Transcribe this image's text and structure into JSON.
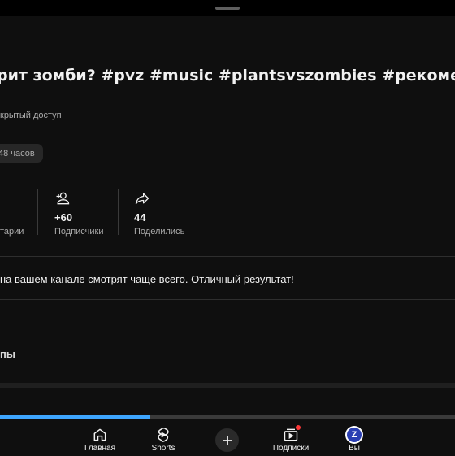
{
  "video": {
    "title": "рит зомби? #pvz #music #plantsvszombies #рекомендации",
    "visibility": "крытый доступ",
    "time_chip": "48 часов"
  },
  "stats": [
    {
      "value": "",
      "label": "тарии",
      "icon": "comment-icon"
    },
    {
      "value": "+60",
      "label": "Подписчики",
      "icon": "add-person-icon"
    },
    {
      "value": "44",
      "label": "Поделились",
      "icon": "share-icon"
    }
  ],
  "insight": {
    "text": "на вашем канале смотрят чаще всего. Отличный результат!"
  },
  "section": {
    "title": "пы"
  },
  "progress": {
    "fraction": 0.33,
    "color": "#3ea6ff"
  },
  "nav": {
    "items": [
      {
        "label": "Главная",
        "icon": "home-icon"
      },
      {
        "label": "Shorts",
        "icon": "shorts-icon"
      },
      {
        "label": "",
        "icon": "plus-icon"
      },
      {
        "label": "Подписки",
        "icon": "subscriptions-icon"
      },
      {
        "label": "Вы",
        "icon": "avatar-icon"
      }
    ],
    "avatar_letter": "Z"
  }
}
